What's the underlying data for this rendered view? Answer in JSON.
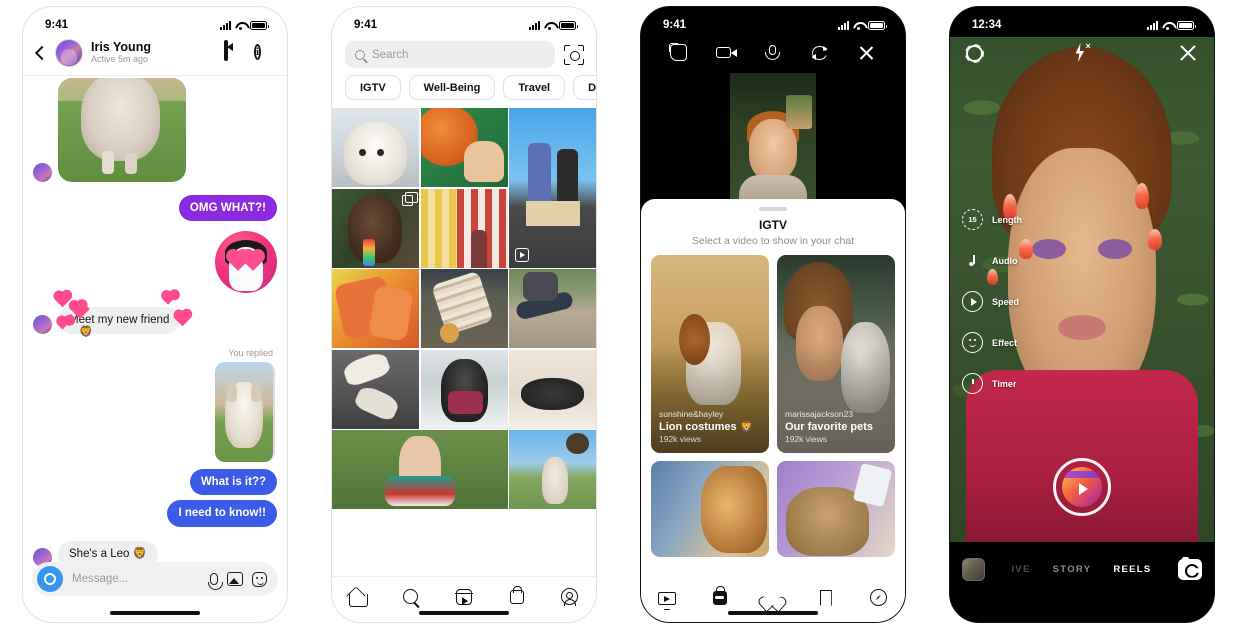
{
  "screens": [
    {
      "id": "direct-message",
      "status_bar": {
        "time": "9:41",
        "signal": "signal-bars-icon",
        "wifi": "wifi-icon",
        "battery": "battery-icon"
      },
      "header": {
        "back": "back-icon",
        "name": "Iris Young",
        "status": "Active 5m ago",
        "video_call": "video-call-icon",
        "info": "info-icon"
      },
      "messages": [
        {
          "type": "photo",
          "side": "left",
          "caption": "cat-photo"
        },
        {
          "type": "text",
          "side": "right",
          "text": "OMG WHAT?!",
          "style": "purple"
        },
        {
          "type": "sticker",
          "side": "right",
          "caption": "heart-eyes-selfie-sticker"
        },
        {
          "type": "text",
          "side": "left",
          "text": "Meet my new friend",
          "style": "grey"
        },
        {
          "type": "reply-label",
          "side": "right",
          "text": "You replied"
        },
        {
          "type": "photo-quote",
          "side": "right",
          "caption": "puppy-photo"
        },
        {
          "type": "text",
          "side": "right",
          "text": "What is it??",
          "style": "blue"
        },
        {
          "type": "text",
          "side": "right",
          "text": "I need to know!!",
          "style": "blue"
        },
        {
          "type": "text",
          "side": "left",
          "text": "She's a Leo 🦁",
          "style": "grey"
        }
      ],
      "composer": {
        "camera": "camera-icon",
        "placeholder": "Message...",
        "mic": "mic-icon",
        "photo": "photo-icon",
        "sticker": "sticker-icon"
      }
    },
    {
      "id": "explore",
      "status_bar": {
        "time": "9:41"
      },
      "search": {
        "placeholder": "Search",
        "icon": "search-icon",
        "scan_icon": "scan-icon"
      },
      "chips": [
        "IGTV",
        "Well-Being",
        "Travel",
        "De"
      ],
      "grid": [
        {
          "alt": "white-fluffy-dog",
          "shape": "square",
          "badge": ""
        },
        {
          "alt": "basketball-player",
          "shape": "square",
          "badge": ""
        },
        {
          "alt": "skateboarders-jumping",
          "shape": "tall",
          "badge": "reels"
        },
        {
          "alt": "woman-with-colorful-earring",
          "shape": "square",
          "badge": "multi"
        },
        {
          "alt": "red-yellow-striped-wall",
          "shape": "square",
          "badge": ""
        },
        {
          "alt": "hands-orange-paint",
          "shape": "square",
          "badge": ""
        },
        {
          "alt": "stacked-bracelets",
          "shape": "square",
          "badge": ""
        },
        {
          "alt": "skateboard-trick",
          "shape": "square",
          "badge": ""
        },
        {
          "alt": "two-dogs-on-pavement",
          "shape": "square",
          "badge": ""
        },
        {
          "alt": "black-dog-in-snow",
          "shape": "square",
          "badge": ""
        },
        {
          "alt": "black-dog-sleeping",
          "shape": "square",
          "badge": ""
        },
        {
          "alt": "person-lying-in-grass",
          "shape": "wide",
          "badge": ""
        },
        {
          "alt": "cat-jumping",
          "shape": "square",
          "badge": ""
        }
      ],
      "tabs": [
        "home-icon",
        "search-icon",
        "reels-icon",
        "shop-icon",
        "profile-icon"
      ]
    },
    {
      "id": "video-chat-igtv",
      "status_bar": {
        "time": "9:41"
      },
      "call_controls": [
        "effects-icon",
        "camera-toggle-icon",
        "mic-icon",
        "flip-camera-icon",
        "close-icon"
      ],
      "sheet": {
        "title": "IGTV",
        "subtitle": "Select a video to show in your chat",
        "videos": [
          {
            "user": "sunshine&hayley",
            "title": "Lion costumes 🦁",
            "views": "192k views",
            "alt": "dog-in-lion-mane-field"
          },
          {
            "user": "marissajackson23",
            "title": "Our favorite pets",
            "views": "192k views",
            "alt": "woman-holding-cat"
          },
          {
            "user": "",
            "title": "",
            "views": "",
            "alt": "lion-portrait"
          },
          {
            "user": "",
            "title": "",
            "views": "",
            "alt": "lion-cub-bottle-feeding"
          }
        ]
      },
      "tabs": [
        "igtv-icon",
        "shop-icon",
        "heart-icon",
        "save-icon",
        "compass-icon"
      ]
    },
    {
      "id": "reels-camera",
      "status_bar": {
        "time": "12:34"
      },
      "top_controls": {
        "settings": "gear-icon",
        "flash": "flash-off-icon",
        "close": "close-icon"
      },
      "tools": [
        {
          "icon": "length-15s-icon",
          "label": "Length",
          "value": "15"
        },
        {
          "icon": "audio-icon",
          "label": "Audio"
        },
        {
          "icon": "speed-icon",
          "label": "Speed"
        },
        {
          "icon": "effect-icon",
          "label": "Effect"
        },
        {
          "icon": "timer-icon",
          "label": "Timer"
        }
      ],
      "shutter": "reels-record-button",
      "gallery": "gallery-thumbnail",
      "modes": [
        {
          "label": "IVE",
          "active": false,
          "clipped": true
        },
        {
          "label": "STORY",
          "active": false,
          "clipped": false
        },
        {
          "label": "REELS",
          "active": true,
          "clipped": false
        }
      ],
      "flip_camera": "flip-camera-icon"
    }
  ],
  "colors": {
    "purple_bubble": "#8a2be2",
    "blue_bubble": "#3b5be8",
    "grey_bubble": "#efefef",
    "camera_blue": "#3797f0"
  }
}
